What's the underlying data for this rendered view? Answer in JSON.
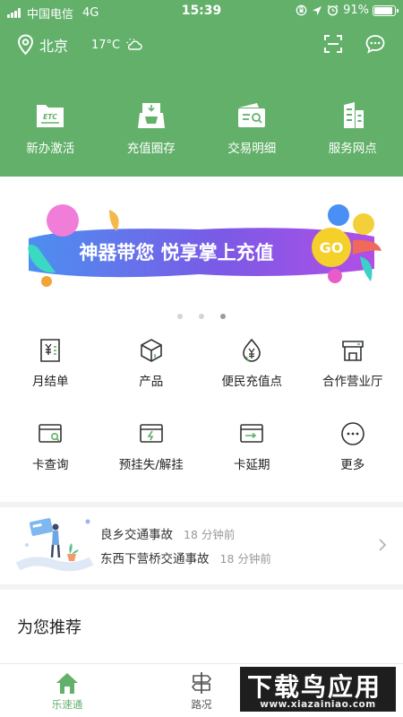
{
  "status_bar": {
    "carrier": "中国电信",
    "network": "4G",
    "time": "15:39",
    "battery": "91%",
    "battery_level": 0.91
  },
  "header": {
    "city": "北京",
    "temperature": "17°C",
    "weather_icon": "cloudy-icon",
    "scan_icon": "scan-icon",
    "message_icon": "chat-icon"
  },
  "quick_actions": [
    {
      "label": "新办激活",
      "icon": "etc-card-icon"
    },
    {
      "label": "充值圈存",
      "icon": "card-reader-icon"
    },
    {
      "label": "交易明细",
      "icon": "wallet-search-icon"
    },
    {
      "label": "服务网点",
      "icon": "building-icon"
    }
  ],
  "banner": {
    "text": "神器带您 悦享掌上充值",
    "go": "GO",
    "dots": 3,
    "active_dot": 2
  },
  "services": [
    {
      "label": "月结单",
      "icon": "monthly-bill-icon"
    },
    {
      "label": "产品",
      "icon": "box-icon"
    },
    {
      "label": "便民充值点",
      "icon": "yuan-drop-icon"
    },
    {
      "label": "合作营业厅",
      "icon": "shop-icon"
    },
    {
      "label": "卡查询",
      "icon": "card-search-icon"
    },
    {
      "label": "预挂失/解挂",
      "icon": "card-lightning-icon"
    },
    {
      "label": "卡延期",
      "icon": "card-arrow-icon"
    },
    {
      "label": "更多",
      "icon": "more-icon"
    }
  ],
  "news": [
    {
      "title": "良乡交通事故",
      "ago": "18 分钟前"
    },
    {
      "title": "东西下营桥交通事故",
      "ago": "18 分钟前"
    }
  ],
  "recommend_title": "为您推荐",
  "tabs": [
    {
      "label": "乐速通",
      "icon": "home-icon",
      "active": true
    },
    {
      "label": "路况",
      "icon": "signpost-icon",
      "active": false
    }
  ],
  "watermark": {
    "title": "下载鸟应用",
    "url": "www.xiazainiao.com"
  },
  "colors": {
    "brand_green": "#62b06a",
    "separator": "#f3f3f3"
  }
}
